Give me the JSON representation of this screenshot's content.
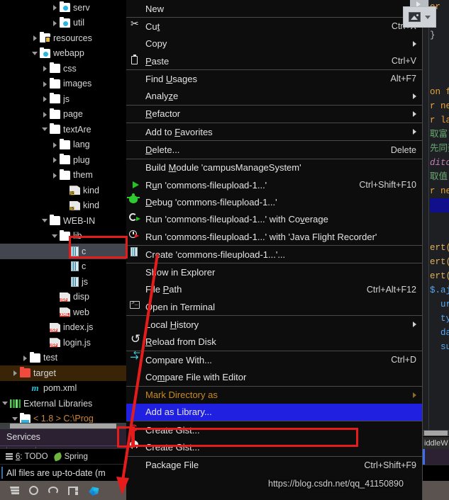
{
  "project_tree": {
    "items": [
      {
        "indent": 5,
        "arrow": "right",
        "icon": "package-folder-icon",
        "label": "serv",
        "color": "white"
      },
      {
        "indent": 5,
        "arrow": "right",
        "icon": "package-folder-icon",
        "label": "util",
        "color": "white"
      },
      {
        "indent": 3,
        "arrow": "right",
        "icon": "resources-folder-icon",
        "label": "resources",
        "color": "white"
      },
      {
        "indent": 3,
        "arrow": "down",
        "icon": "webapp-folder-icon",
        "label": "webapp",
        "color": "white"
      },
      {
        "indent": 4,
        "arrow": "right",
        "icon": "folder-icon",
        "label": "css",
        "color": "white"
      },
      {
        "indent": 4,
        "arrow": "right",
        "icon": "folder-icon",
        "label": "images",
        "color": "white"
      },
      {
        "indent": 4,
        "arrow": "right",
        "icon": "folder-icon",
        "label": "js",
        "color": "white"
      },
      {
        "indent": 4,
        "arrow": "right",
        "icon": "folder-icon",
        "label": "page",
        "color": "white"
      },
      {
        "indent": 4,
        "arrow": "down",
        "icon": "folder-icon",
        "label": "textAre",
        "color": "white"
      },
      {
        "indent": 5,
        "arrow": "right",
        "icon": "folder-icon",
        "label": "lang",
        "color": "white"
      },
      {
        "indent": 5,
        "arrow": "right",
        "icon": "folder-icon",
        "label": "plug",
        "color": "white"
      },
      {
        "indent": 5,
        "arrow": "right",
        "icon": "folder-icon",
        "label": "them",
        "color": "white"
      },
      {
        "indent": 6,
        "arrow": "none",
        "icon": "js-file-icon",
        "badge": "JS",
        "label": "kind",
        "color": "white"
      },
      {
        "indent": 6,
        "arrow": "none",
        "icon": "js-min-file-icon",
        "badge": "JS",
        "label": "kind",
        "color": "white"
      },
      {
        "indent": 4,
        "arrow": "down",
        "icon": "folder-icon",
        "label": "WEB-IN",
        "color": "white"
      },
      {
        "indent": 5,
        "arrow": "down",
        "icon": "folder-icon",
        "label": "lib",
        "color": "white"
      },
      {
        "indent": 6,
        "arrow": "none",
        "icon": "jar-file-icon",
        "label": "c",
        "color": "white",
        "selected": true
      },
      {
        "indent": 6,
        "arrow": "none",
        "icon": "jar-file-icon",
        "label": "c",
        "color": "white"
      },
      {
        "indent": 6,
        "arrow": "none",
        "icon": "jar-file-icon",
        "label": "js",
        "color": "white"
      },
      {
        "indent": 5,
        "arrow": "none",
        "icon": "jsp-file-icon",
        "badge": "JSP",
        "label": "disp",
        "color": "white"
      },
      {
        "indent": 5,
        "arrow": "none",
        "icon": "xml-file-icon",
        "badge": "XML",
        "label": "web",
        "color": "white"
      },
      {
        "indent": 4,
        "arrow": "none",
        "icon": "jsp-file-icon",
        "badge": "JSP",
        "label": "index.js",
        "color": "white"
      },
      {
        "indent": 4,
        "arrow": "none",
        "icon": "jsp-file-icon",
        "badge": "JSP",
        "label": "login.js",
        "color": "white"
      },
      {
        "indent": 2,
        "arrow": "right",
        "icon": "folder-icon",
        "label": "test",
        "color": "white"
      },
      {
        "indent": 1,
        "arrow": "right",
        "icon": "folder-red-icon",
        "label": "target",
        "color": "white",
        "row_highlight": "target"
      },
      {
        "indent": 2,
        "arrow": "none",
        "icon": "maven-icon",
        "label": "pom.xml",
        "color": "white"
      },
      {
        "indent": 0,
        "arrow": "down",
        "icon": "external-libraries-icon",
        "label": "External Libraries",
        "color": "white"
      },
      {
        "indent": 1,
        "arrow": "down",
        "icon": "jdk-folder-icon",
        "label": "< 1.8 >  C:\\Prog",
        "color": "orange"
      }
    ]
  },
  "services_panel": {
    "title": "Services"
  },
  "bottom_tool_bar": {
    "items": [
      {
        "label_prefix": "6",
        "label": ": TODO",
        "icon": "todo-icon"
      },
      {
        "label_prefix": "",
        "label": "Spring",
        "icon": "spring-icon"
      }
    ]
  },
  "status_bar": {
    "text": "All files are up-to-date (m"
  },
  "taskbar": {
    "icons": [
      "start-icon",
      "search-icon",
      "cortana-icon",
      "task-view-icon",
      "edge-icon"
    ]
  },
  "editor": {
    "lines": [
      {
        "text": "er",
        "cls": "c-org"
      },
      {
        "text": "",
        "cls": ""
      },
      {
        "text": "}",
        "cls": "c-txt"
      },
      {
        "text": "",
        "cls": ""
      },
      {
        "text": "",
        "cls": ""
      },
      {
        "text": "",
        "cls": ""
      },
      {
        "text": "on f",
        "cls": "c-org"
      },
      {
        "text": "r ne",
        "cls": "c-org"
      },
      {
        "text": "r la",
        "cls": "c-org"
      },
      {
        "text": "取富フ",
        "cls": "c-str"
      },
      {
        "text": "先同発",
        "cls": "c-str"
      },
      {
        "text": "ditor",
        "cls": "c-var"
      },
      {
        "text": "取值",
        "cls": "c-str"
      },
      {
        "text": "r ne",
        "cls": "c-org"
      },
      {
        "text": "",
        "cls": "hl"
      },
      {
        "text": "",
        "cls": ""
      },
      {
        "text": "",
        "cls": ""
      },
      {
        "text": "ert(",
        "cls": "c-fn"
      },
      {
        "text": "ert(",
        "cls": "c-fn"
      },
      {
        "text": "ert(",
        "cls": "c-fn"
      },
      {
        "text": "$.aj",
        "cls": "c-blu"
      },
      {
        "text": "  ur",
        "cls": "c-blu"
      },
      {
        "text": "  ty",
        "cls": "c-blu"
      },
      {
        "text": "  da",
        "cls": "c-blu"
      },
      {
        "text": "  su",
        "cls": "c-blu"
      }
    ],
    "bottom_label": "iddleW"
  },
  "context_menu": {
    "items": [
      {
        "label": "New",
        "mnemonic": "",
        "shortcut": "",
        "submenu": true,
        "icon": "",
        "sep_after": true
      },
      {
        "label": "Cut",
        "mnemonic": "t",
        "shortcut": "Ctrl+X",
        "submenu": false,
        "icon": "scissors-icon"
      },
      {
        "label": "Copy",
        "mnemonic": "",
        "shortcut": "",
        "submenu": true,
        "icon": ""
      },
      {
        "label": "Paste",
        "mnemonic": "P",
        "shortcut": "Ctrl+V",
        "submenu": false,
        "icon": "clipboard-icon",
        "sep_after": true
      },
      {
        "label": "Find Usages",
        "mnemonic": "U",
        "shortcut": "Alt+F7",
        "submenu": false,
        "icon": ""
      },
      {
        "label": "Analyze",
        "mnemonic": "z",
        "shortcut": "",
        "submenu": true,
        "icon": "",
        "sep_after": true
      },
      {
        "label": "Refactor",
        "mnemonic": "R",
        "shortcut": "",
        "submenu": true,
        "icon": "",
        "sep_after": true
      },
      {
        "label": "Add to Favorites",
        "mnemonic": "F",
        "shortcut": "",
        "submenu": true,
        "icon": "",
        "sep_after": true
      },
      {
        "label": "Delete...",
        "mnemonic": "D",
        "shortcut": "Delete",
        "submenu": false,
        "icon": "",
        "sep_after": true
      },
      {
        "label": "Build Module 'campusManageSystem'",
        "mnemonic": "M",
        "shortcut": "",
        "submenu": false,
        "icon": ""
      },
      {
        "label": "Run 'commons-fileupload-1...'",
        "mnemonic": "u",
        "shortcut": "Ctrl+Shift+F10",
        "submenu": false,
        "icon": "run-icon"
      },
      {
        "label": "Debug 'commons-fileupload-1...'",
        "mnemonic": "D",
        "shortcut": "",
        "submenu": false,
        "icon": "debug-icon"
      },
      {
        "label": "Run 'commons-fileupload-1...' with Coverage",
        "mnemonic": "v",
        "shortcut": "",
        "submenu": false,
        "icon": "coverage-icon"
      },
      {
        "label": "Run 'commons-fileupload-1...' with 'Java Flight Recorder'",
        "mnemonic": "",
        "shortcut": "",
        "submenu": false,
        "icon": "flight-recorder-icon",
        "sep_after": true
      },
      {
        "label": "Create 'commons-fileupload-1...'...",
        "mnemonic": "",
        "shortcut": "",
        "submenu": false,
        "icon": "jar-icon",
        "sep_after": true
      },
      {
        "label": "Show in Explorer",
        "mnemonic": "",
        "shortcut": "",
        "submenu": false,
        "icon": ""
      },
      {
        "label": "File Path",
        "mnemonic": "P",
        "shortcut": "Ctrl+Alt+F12",
        "submenu": false,
        "icon": ""
      },
      {
        "label": "Open in Terminal",
        "mnemonic": "",
        "shortcut": "",
        "submenu": false,
        "icon": "terminal-icon",
        "sep_after": true
      },
      {
        "label": "Local History",
        "mnemonic": "H",
        "shortcut": "",
        "submenu": true,
        "icon": ""
      },
      {
        "label": "Reload from Disk",
        "mnemonic": "R",
        "shortcut": "",
        "submenu": false,
        "icon": "reload-icon",
        "sep_after": true
      },
      {
        "label": "Compare With...",
        "mnemonic": "",
        "shortcut": "Ctrl+D",
        "submenu": false,
        "icon": "compare-icon"
      },
      {
        "label": "Compare File with Editor",
        "mnemonic": "m",
        "shortcut": "",
        "submenu": false,
        "icon": "",
        "sep_after": true
      },
      {
        "label": "Mark Directory as",
        "mnemonic": "",
        "shortcut": "",
        "submenu": true,
        "icon": "",
        "dim": true
      },
      {
        "label": "Add as Library...",
        "mnemonic": "",
        "shortcut": "",
        "submenu": false,
        "icon": "",
        "selected": true,
        "sep_after": true
      },
      {
        "label": "Create Gist...",
        "mnemonic": "",
        "shortcut": "",
        "submenu": false,
        "icon": "gitlab-gist-icon"
      },
      {
        "label": "Create Gist...",
        "mnemonic": "",
        "shortcut": "",
        "submenu": false,
        "icon": "github-gist-icon",
        "sep_after": true
      },
      {
        "label": "Package File",
        "mnemonic": "",
        "shortcut": "Ctrl+Shift+F9",
        "submenu": false,
        "icon": ""
      }
    ]
  },
  "watermark": {
    "text": "https://blog.csdn.net/qq_41150890"
  },
  "colors": {
    "menu_bg": "#0d0d0d",
    "menu_selected": "#2020e0",
    "annotation_red": "#e51c1c",
    "tree_selected": "#43454f",
    "target_row": "#3a2408",
    "mark_dir_orange": "#c98a1e"
  }
}
